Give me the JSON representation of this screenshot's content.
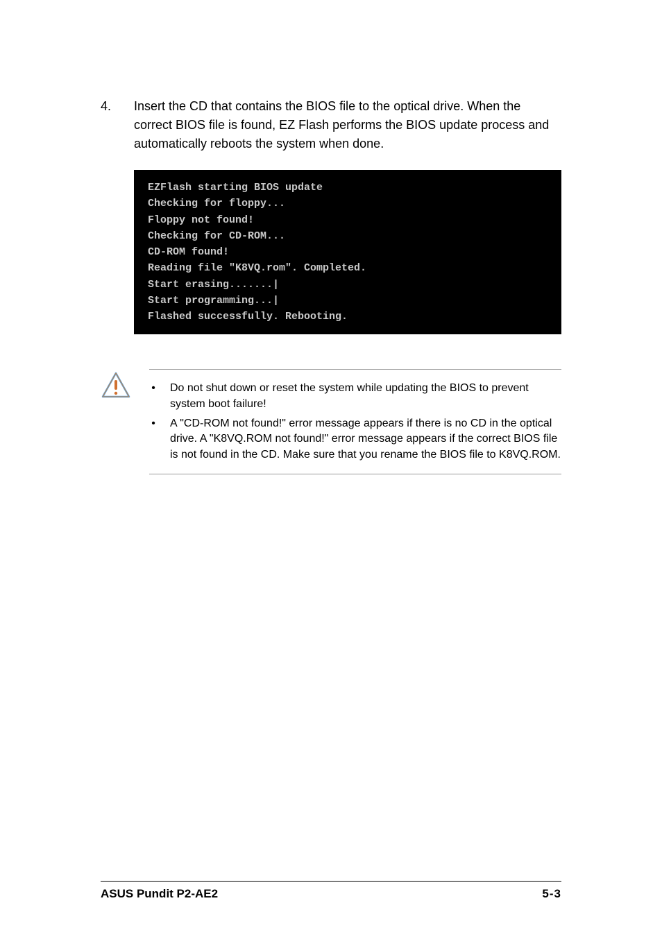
{
  "step": {
    "number": "4.",
    "text": "Insert the CD that contains the BIOS file to the optical drive. When the correct BIOS file is found, EZ Flash performs the BIOS update process and automatically reboots the system when done."
  },
  "terminal": {
    "lines": [
      "EZFlash starting BIOS update",
      "Checking for floppy...",
      "Floppy not found!",
      "Checking for CD-ROM...",
      "CD-ROM found!",
      "Reading file \"K8VQ.rom\". Completed.",
      "Start erasing.......|",
      "Start programming...|",
      "Flashed successfully. Rebooting."
    ]
  },
  "notes": [
    "Do not shut down or reset the system while updating the BIOS to prevent system boot failure!",
    "A \"CD-ROM not found!\" error message appears if there is no CD in the optical drive. A \"K8VQ.ROM not found!\" error message appears if the correct BIOS file is not found in the CD. Make sure that you rename the BIOS file to K8VQ.ROM."
  ],
  "footer": {
    "left": "ASUS Pundit P2-AE2",
    "right": "5-3"
  },
  "bullet_char": "•"
}
